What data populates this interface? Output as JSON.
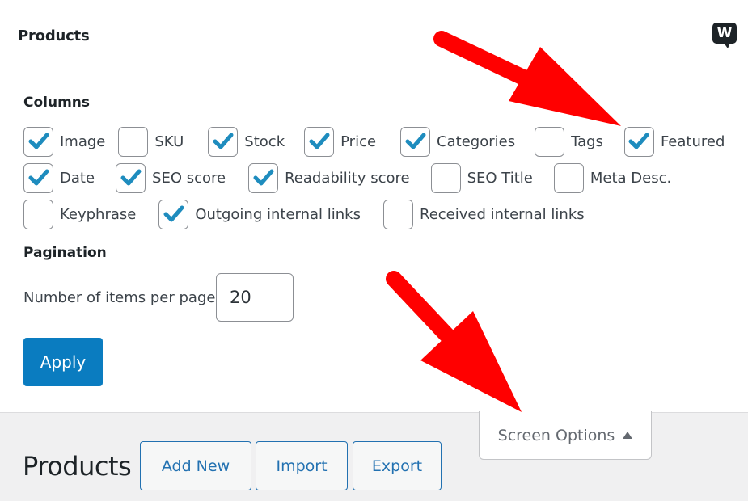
{
  "panel": {
    "title": "Products",
    "logo_letter": "W",
    "columns_label": "Columns",
    "columns": [
      {
        "label": "Image",
        "checked": true
      },
      {
        "label": "SKU",
        "checked": false
      },
      {
        "label": "Stock",
        "checked": true
      },
      {
        "label": "Price",
        "checked": true
      },
      {
        "label": "Categories",
        "checked": true
      },
      {
        "label": "Tags",
        "checked": false
      },
      {
        "label": "Featured",
        "checked": true
      },
      {
        "label": "Date",
        "checked": true
      },
      {
        "label": "SEO score",
        "checked": true
      },
      {
        "label": "Readability score",
        "checked": true
      },
      {
        "label": "SEO Title",
        "checked": false
      },
      {
        "label": "Meta Desc.",
        "checked": false
      },
      {
        "label": "Keyphrase",
        "checked": false
      },
      {
        "label": "Outgoing internal links",
        "checked": true
      },
      {
        "label": "Received internal links",
        "checked": false
      }
    ],
    "pagination_label": "Pagination",
    "per_page_label": "Number of items per page:",
    "per_page_value": "20",
    "apply_label": "Apply"
  },
  "screen_options": {
    "label": "Screen Options",
    "arrow_icon": "triangle-up"
  },
  "page": {
    "title": "Products",
    "buttons": {
      "add_new": "Add New",
      "import": "Import",
      "export": "Export"
    }
  },
  "colors": {
    "accent": "#2271b1",
    "apply_button": "#0a7cc0",
    "checkmark": "#1e8cbe",
    "annotation_arrow": "#ff0000"
  }
}
